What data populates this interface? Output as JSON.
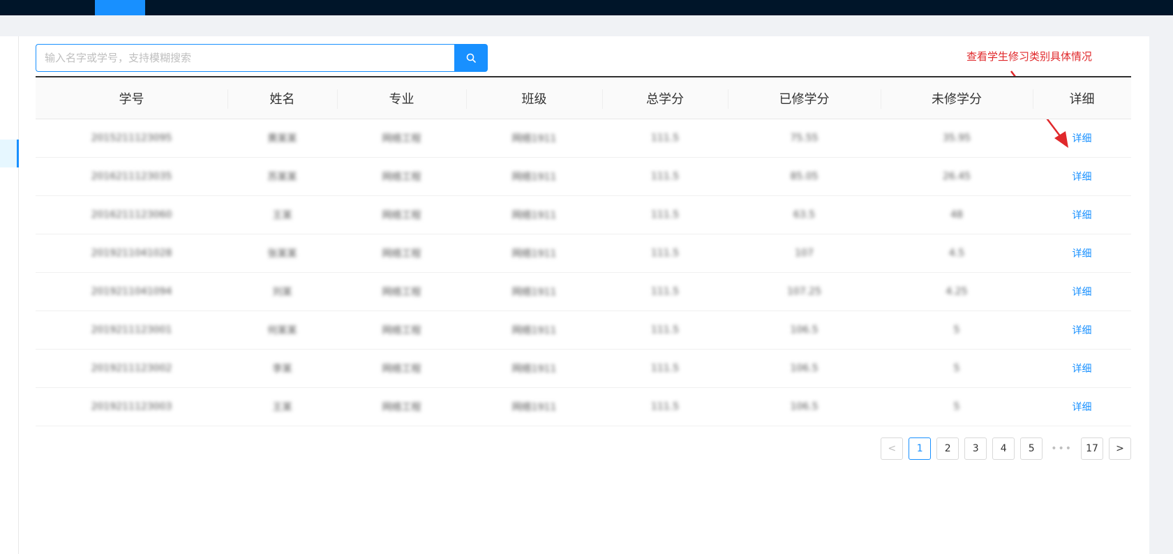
{
  "search": {
    "placeholder": "输入名字或学号，支持模糊搜索"
  },
  "annotation": "查看学生修习类别具体情况",
  "table": {
    "columns": [
      "学号",
      "姓名",
      "专业",
      "班级",
      "总学分",
      "已修学分",
      "未修学分",
      "详细"
    ],
    "rows": [
      [
        "2015211123095",
        "黄某某",
        "网络工程",
        "网络1911",
        "111.5",
        "75.55",
        "35.95",
        "详细"
      ],
      [
        "2016211123035",
        "苏某某",
        "网络工程",
        "网络1911",
        "111.5",
        "85.05",
        "26.45",
        "详细"
      ],
      [
        "2016211123060",
        "王某",
        "网络工程",
        "网络1911",
        "111.5",
        "63.5",
        "48",
        "详细"
      ],
      [
        "2019211041028",
        "张某某",
        "网络工程",
        "网络1911",
        "111.5",
        "107",
        "4.5",
        "详细"
      ],
      [
        "2019211041094",
        "刘某",
        "网络工程",
        "网络1911",
        "111.5",
        "107.25",
        "4.25",
        "详细"
      ],
      [
        "2019211123001",
        "何某某",
        "网络工程",
        "网络1911",
        "111.5",
        "106.5",
        "5",
        "详细"
      ],
      [
        "2019211123002",
        "李某",
        "网络工程",
        "网络1911",
        "111.5",
        "106.5",
        "5",
        "详细"
      ],
      [
        "2019211123003",
        "王某",
        "网络工程",
        "网络1911",
        "111.5",
        "106.5",
        "5",
        "详细"
      ]
    ]
  },
  "pagination": {
    "prev": "<",
    "pages": [
      "1",
      "2",
      "3",
      "4",
      "5"
    ],
    "ellipsis": "•••",
    "last": "17",
    "next": ">",
    "current": "1"
  },
  "colors": {
    "accent": "#1890ff",
    "topbar": "#001529",
    "annotation": "#e0282b"
  },
  "icons": {
    "search_button": "search-icon",
    "annotation_arrow": "arrow-icon"
  }
}
